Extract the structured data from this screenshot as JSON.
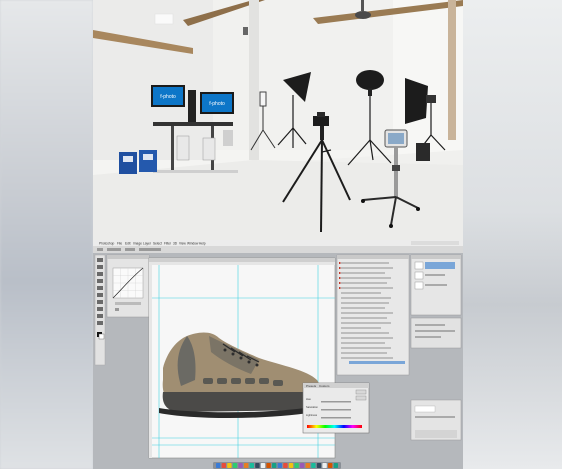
{
  "photo": {
    "monitor_text": "f-photo",
    "colors": {
      "wall": "#f3f3f1",
      "floor": "#eeeeec",
      "beam": "#a8875e",
      "black": "#1c1c1c"
    }
  },
  "photoshop": {
    "menu_items": [
      "Photoshop",
      "File",
      "Edit",
      "Image",
      "Layer",
      "Select",
      "Filter",
      "3D",
      "View",
      "Window",
      "Help"
    ],
    "dialog": {
      "tabs": [
        "Presets",
        "Custom"
      ],
      "slider_labels": [
        "Hue",
        "Saturation",
        "Lightness"
      ]
    },
    "dock_icon_count": 22
  }
}
